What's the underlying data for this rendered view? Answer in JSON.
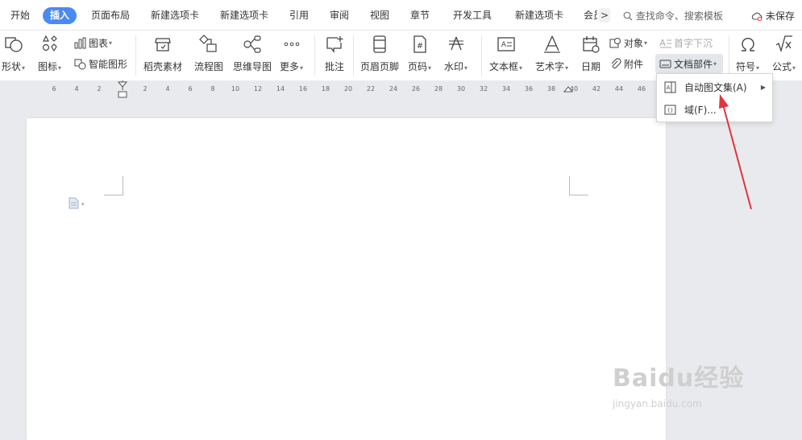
{
  "tabs": [
    {
      "label": "开始"
    },
    {
      "label": "插入"
    },
    {
      "label": "页面布局"
    },
    {
      "label": "新建选项卡"
    },
    {
      "label": "新建选项卡"
    },
    {
      "label": "引用"
    },
    {
      "label": "审阅"
    },
    {
      "label": "视图"
    },
    {
      "label": "章节"
    },
    {
      "label": "开发工具"
    },
    {
      "label": "新建选项卡"
    },
    {
      "label": "会员"
    }
  ],
  "tab_more_symbol": ">",
  "search_placeholder": "查找命令、搜索模板",
  "unsaved_label": "未保存",
  "ribbon": {
    "shape": "形状",
    "icon_lib": "图标",
    "chart": "图表",
    "smart_shape": "智能图形",
    "daoke": "稻壳素材",
    "flowchart": "流程图",
    "mindmap": "思维导图",
    "more": "更多",
    "comment": "批注",
    "header_footer": "页眉页脚",
    "page_number": "页码",
    "watermark": "水印",
    "textbox": "文本框",
    "wordart": "艺术字",
    "date": "日期",
    "object": "对象",
    "attachment": "附件",
    "drop_cap": "首字下沉",
    "doc_parts": "文档部件",
    "symbol": "符号",
    "formula": "公式"
  },
  "ruler_ticks": [
    "6",
    "4",
    "2",
    "2",
    "4",
    "6",
    "8",
    "10",
    "12",
    "14",
    "16",
    "18",
    "20",
    "22",
    "24",
    "26",
    "28",
    "30",
    "32",
    "34",
    "36",
    "38",
    "40",
    "42",
    "44",
    "46"
  ],
  "menu": {
    "autotext": "自动图文集(A)",
    "field": "域(F)..."
  },
  "watermark": {
    "main": "Baidu经验",
    "sub": "jingyan.baidu.com"
  },
  "colors": {
    "accent": "#4a8af4",
    "annotation_arrow": "#e0353f"
  }
}
